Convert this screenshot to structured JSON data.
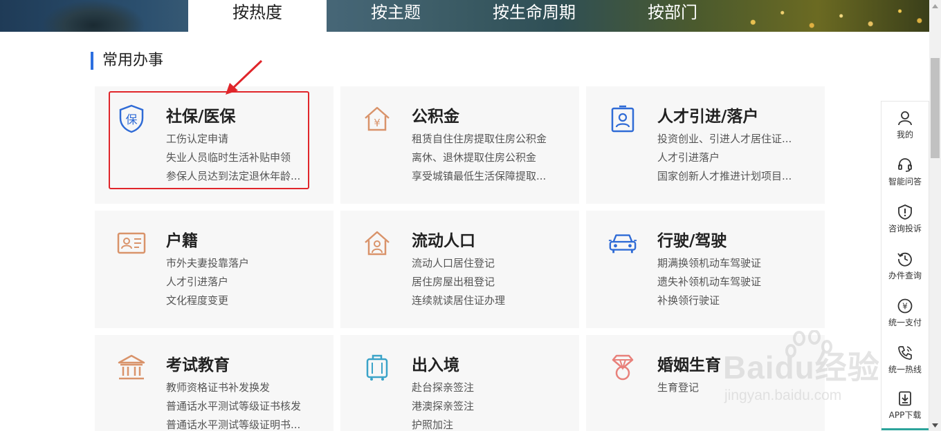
{
  "tabs": [
    {
      "label": "按热度",
      "active": true
    },
    {
      "label": "按主题",
      "active": false
    },
    {
      "label": "按生命周期",
      "active": false
    },
    {
      "label": "按部门",
      "active": false
    }
  ],
  "section_title": "常用办事",
  "cards": [
    {
      "title": "社保/医保",
      "icon": "shield-bao-icon",
      "icon_color": "#2f6bd6",
      "links": [
        "工伤认定申请",
        "失业人员临时生活补贴申领",
        "参保人员达到法定退休年龄..."
      ]
    },
    {
      "title": "公积金",
      "icon": "house-yuan-icon",
      "icon_color": "#d9936a",
      "links": [
        "租赁自住住房提取住房公积金",
        "离休、退休提取住房公积金",
        "享受城镇最低生活保障提取..."
      ]
    },
    {
      "title": "人才引进/落户",
      "icon": "id-badge-icon",
      "icon_color": "#2f6bd6",
      "links": [
        "投资创业、引进人才居住证...",
        "人才引进落户",
        "国家创新人才推进计划项目..."
      ]
    },
    {
      "title": "户籍",
      "icon": "id-card-icon",
      "icon_color": "#d9936a",
      "links": [
        "市外夫妻投靠落户",
        "人才引进落户",
        "文化程度变更"
      ]
    },
    {
      "title": "流动人口",
      "icon": "house-person-icon",
      "icon_color": "#d9936a",
      "links": [
        "流动人口居住登记",
        "居住房屋出租登记",
        "连续就读居住证办理"
      ]
    },
    {
      "title": "行驶/驾驶",
      "icon": "car-icon",
      "icon_color": "#2f6bd6",
      "links": [
        "期满换领机动车驾驶证",
        "遗失补领机动车驾驶证",
        "补换领行驶证"
      ]
    },
    {
      "title": "考试教育",
      "icon": "building-icon",
      "icon_color": "#d9936a",
      "links": [
        "教师资格证书补发换发",
        "普通话水平测试等级证书核发",
        "普通话水平测试等级证明书..."
      ]
    },
    {
      "title": "出入境",
      "icon": "luggage-icon",
      "icon_color": "#3aa3c8",
      "links": [
        "赴台探亲签注",
        "港澳探亲签注",
        "护照加注"
      ]
    },
    {
      "title": "婚姻生育",
      "icon": "diamond-ring-icon",
      "icon_color": "#e8807a",
      "links": [
        "生育登记"
      ]
    }
  ],
  "float_bar": [
    {
      "label": "我的",
      "icon": "user-icon"
    },
    {
      "label": "智能问答",
      "icon": "headset-icon"
    },
    {
      "label": "咨询投诉",
      "icon": "alert-shield-icon"
    },
    {
      "label": "办件查询",
      "icon": "history-icon"
    },
    {
      "label": "统一支付",
      "icon": "yuan-circle-icon"
    },
    {
      "label": "统一热线",
      "icon": "phone-icon"
    },
    {
      "label": "APP下载",
      "icon": "download-icon"
    }
  ],
  "watermark": {
    "main": "Baidu经验",
    "sub": "jingyan.baidu.com"
  },
  "colors": {
    "accent": "#2c6fe0",
    "highlight": "#e0252a",
    "card_bg": "#f7f7f7"
  }
}
